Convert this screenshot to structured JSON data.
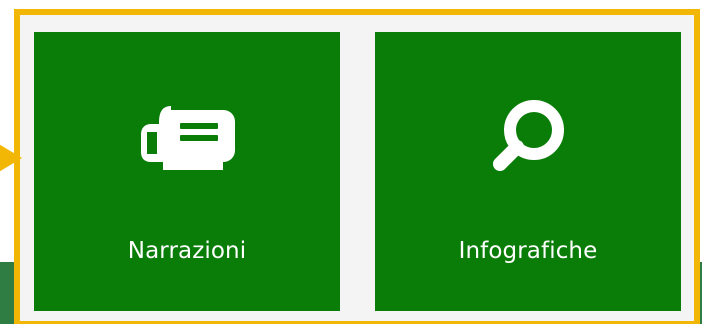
{
  "tiles": [
    {
      "label": "Narrazioni",
      "icon": "newspaper-icon"
    },
    {
      "label": "Infografiche",
      "icon": "search-icon"
    }
  ],
  "colors": {
    "tile_background": "#0a7d09",
    "highlight_border": "#f2b705",
    "panel_background": "#f4f4f4",
    "page_footer_band": "#2f7d42",
    "label_text": "#ffffff"
  }
}
